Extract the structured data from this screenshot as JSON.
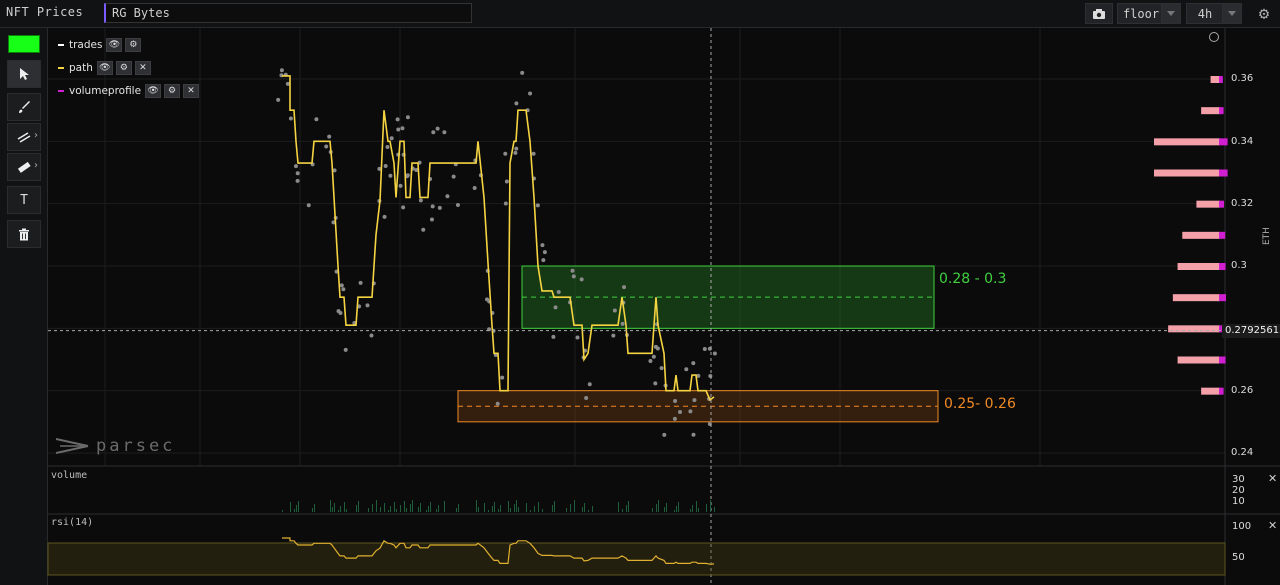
{
  "header": {
    "app_title": "NFT Prices",
    "collection_value": "RG Bytes",
    "metric_label": "floor",
    "interval_label": "4h"
  },
  "sidebar": {
    "active_color": "#17ff17",
    "tools": [
      "cursor-icon",
      "brush-icon",
      "parallel-lines-icon",
      "ruler-icon",
      "text-icon",
      "trash-icon"
    ],
    "text_tool_label": "T"
  },
  "legend": {
    "items": [
      {
        "label": "trades",
        "color": "#ffffff"
      },
      {
        "label": "path",
        "color": "#f5d442"
      },
      {
        "label": "volumeprofile",
        "color": "#d01fd0"
      }
    ]
  },
  "price_axis": {
    "unit": "ETH",
    "ticks": [
      "0.36",
      "0.34",
      "0.32",
      "0.3",
      "0.28",
      "0.26",
      "0.24"
    ],
    "crosshair_value": "0.27925613"
  },
  "zones": [
    {
      "label": "0.28 - 0.3",
      "color": "#3fd13f"
    },
    {
      "label": "0.25- 0.26",
      "color": "#f08a24"
    }
  ],
  "watermark": "parsec",
  "volume_panel": {
    "label": "volume",
    "ticks": [
      "30",
      "20",
      "10"
    ]
  },
  "rsi_panel": {
    "label": "rsi(14)",
    "ticks": [
      "100",
      "50"
    ]
  },
  "chart_data": {
    "type": "line",
    "path": [
      [
        0,
        0.361
      ],
      [
        8,
        0.361
      ],
      [
        8,
        0.35
      ],
      [
        12,
        0.35
      ],
      [
        14,
        0.34
      ],
      [
        16,
        0.333
      ],
      [
        30,
        0.333
      ],
      [
        32,
        0.34
      ],
      [
        48,
        0.34
      ],
      [
        50,
        0.333
      ],
      [
        52,
        0.322
      ],
      [
        56,
        0.3
      ],
      [
        58,
        0.29
      ],
      [
        62,
        0.29
      ],
      [
        64,
        0.281
      ],
      [
        74,
        0.281
      ],
      [
        76,
        0.29
      ],
      [
        86,
        0.29
      ],
      [
        90,
        0.29
      ],
      [
        94,
        0.31
      ],
      [
        98,
        0.321
      ],
      [
        102,
        0.35
      ],
      [
        106,
        0.34
      ],
      [
        108,
        0.34
      ],
      [
        112,
        0.333
      ],
      [
        114,
        0.322
      ],
      [
        118,
        0.34
      ],
      [
        122,
        0.34
      ],
      [
        124,
        0.322
      ],
      [
        128,
        0.322
      ],
      [
        130,
        0.333
      ],
      [
        136,
        0.333
      ],
      [
        138,
        0.322
      ],
      [
        144,
        0.322
      ],
      [
        146,
        0.322
      ],
      [
        148,
        0.333
      ],
      [
        154,
        0.333
      ],
      [
        156,
        0.333
      ],
      [
        162,
        0.333
      ],
      [
        174,
        0.333
      ],
      [
        176,
        0.333
      ],
      [
        194,
        0.333
      ],
      [
        196,
        0.34
      ],
      [
        202,
        0.322
      ],
      [
        206,
        0.301
      ],
      [
        210,
        0.281
      ],
      [
        212,
        0.272
      ],
      [
        216,
        0.272
      ],
      [
        218,
        0.26
      ],
      [
        226,
        0.26
      ],
      [
        228,
        0.333
      ],
      [
        232,
        0.34
      ],
      [
        234,
        0.34
      ],
      [
        236,
        0.35
      ],
      [
        244,
        0.35
      ],
      [
        248,
        0.34
      ],
      [
        252,
        0.322
      ],
      [
        256,
        0.3
      ],
      [
        260,
        0.292
      ],
      [
        270,
        0.292
      ],
      [
        272,
        0.29
      ],
      [
        284,
        0.29
      ],
      [
        288,
        0.29
      ],
      [
        292,
        0.281
      ],
      [
        300,
        0.281
      ],
      [
        302,
        0.27
      ],
      [
        306,
        0.272
      ],
      [
        310,
        0.281
      ],
      [
        336,
        0.281
      ],
      [
        340,
        0.29
      ],
      [
        344,
        0.281
      ],
      [
        346,
        0.272
      ],
      [
        370,
        0.272
      ],
      [
        374,
        0.29
      ],
      [
        376,
        0.281
      ],
      [
        382,
        0.272
      ],
      [
        384,
        0.26
      ],
      [
        392,
        0.26
      ],
      [
        394,
        0.265
      ],
      [
        396,
        0.26
      ],
      [
        408,
        0.26
      ],
      [
        410,
        0.265
      ],
      [
        414,
        0.265
      ],
      [
        416,
        0.26
      ],
      [
        424,
        0.26
      ],
      [
        428,
        0.257
      ],
      [
        432,
        0.258
      ]
    ],
    "zone_ranges": [
      [
        0.28,
        0.3
      ],
      [
        0.25,
        0.26
      ]
    ],
    "volume_profile": [
      {
        "price": 0.36,
        "value": 2
      },
      {
        "price": 0.35,
        "value": 4
      },
      {
        "price": 0.34,
        "value": 14
      },
      {
        "price": 0.33,
        "value": 14
      },
      {
        "price": 0.32,
        "value": 5
      },
      {
        "price": 0.31,
        "value": 8
      },
      {
        "price": 0.3,
        "value": 9
      },
      {
        "price": 0.29,
        "value": 10
      },
      {
        "price": 0.28,
        "value": 11
      },
      {
        "price": 0.27,
        "value": 9
      },
      {
        "price": 0.26,
        "value": 4
      }
    ],
    "ylim": [
      0.24,
      0.37
    ],
    "ylabel": "ETH"
  }
}
